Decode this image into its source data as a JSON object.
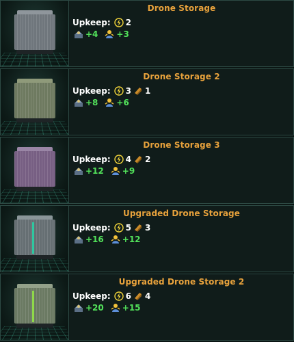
{
  "colors": {
    "title": "#e8a23c",
    "bonus": "#52e15a",
    "text": "#ffffff",
    "panel_border": "#2d4a44",
    "energy": "#f2d43a",
    "alloys": "#c98a2a"
  },
  "upkeep_label": "Upkeep:",
  "buildings": [
    {
      "title": "Drone Storage",
      "tint": "gray",
      "upkeep": [
        {
          "icon": "energy-icon",
          "value": "2"
        }
      ],
      "production": [
        {
          "icon": "housing-icon",
          "value": "+4"
        },
        {
          "icon": "amenities-icon",
          "value": "+3"
        }
      ]
    },
    {
      "title": "Drone Storage 2",
      "tint": "olive",
      "upkeep": [
        {
          "icon": "energy-icon",
          "value": "3"
        },
        {
          "icon": "alloys-icon",
          "value": "1"
        }
      ],
      "production": [
        {
          "icon": "housing-icon",
          "value": "+8"
        },
        {
          "icon": "amenities-icon",
          "value": "+6"
        }
      ]
    },
    {
      "title": "Drone Storage 3",
      "tint": "purple",
      "upkeep": [
        {
          "icon": "energy-icon",
          "value": "4"
        },
        {
          "icon": "alloys-icon",
          "value": "2"
        }
      ],
      "production": [
        {
          "icon": "housing-icon",
          "value": "+12"
        },
        {
          "icon": "amenities-icon",
          "value": "+9"
        }
      ]
    },
    {
      "title": "Upgraded Drone Storage",
      "tint": "teal",
      "upkeep": [
        {
          "icon": "energy-icon",
          "value": "5"
        },
        {
          "icon": "alloys-icon",
          "value": "3"
        }
      ],
      "production": [
        {
          "icon": "housing-icon",
          "value": "+16"
        },
        {
          "icon": "amenities-icon",
          "value": "+12"
        }
      ]
    },
    {
      "title": "Upgraded Drone Storage 2",
      "tint": "green",
      "upkeep": [
        {
          "icon": "energy-icon",
          "value": "6"
        },
        {
          "icon": "alloys-icon",
          "value": "4"
        }
      ],
      "production": [
        {
          "icon": "housing-icon",
          "value": "+20"
        },
        {
          "icon": "amenities-icon",
          "value": "+15"
        }
      ]
    }
  ]
}
